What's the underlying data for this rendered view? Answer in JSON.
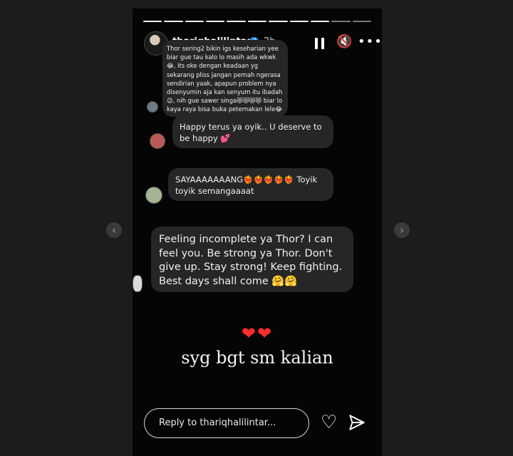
{
  "story": {
    "progress_segments": [
      1,
      1,
      1,
      1,
      1,
      1,
      1,
      1,
      1,
      0,
      0
    ],
    "header": {
      "username": "thariqhalilintar",
      "verified_icon": "✔",
      "time": "2h",
      "mute_icon": "🔇",
      "more_icon": "•••"
    },
    "comments": [
      {
        "text": "Thor sering2 bikin igs keseharian yee biar gue tau kalo lo masih ada wkwk😂, its oke dengan keadaan yg sekarang pliss jangan pernah ngerasa sendirian yaak, apapun problem nya disenyumin aja kan senyum itu ibadah😉, nih gue sawer singa😻😻😻😻 biar lo kaya raya bisa buka peternakan lele😂"
      },
      {
        "text": "Happy terus ya oyik.. U deserve to be happy 💕"
      },
      {
        "text": "SAYAAAAAAANG❤️‍🔥❤️‍🔥❤️‍🔥❤️‍🔥❤️‍🔥 Toyik toyik semangaaaat"
      },
      {
        "text": "Feeling incomplete ya Thor? I can feel you. Be strong ya Thor. Don't give up. Stay strong! Keep fighting. Best days shall come 🤗🤗"
      }
    ],
    "hearts": "❤❤",
    "caption": "syg bgt sm kalian",
    "reply_placeholder": "Reply to thariqhalilintar...",
    "like_icon": "♡"
  },
  "nav": {
    "prev_icon": "‹",
    "next_icon": "›"
  }
}
